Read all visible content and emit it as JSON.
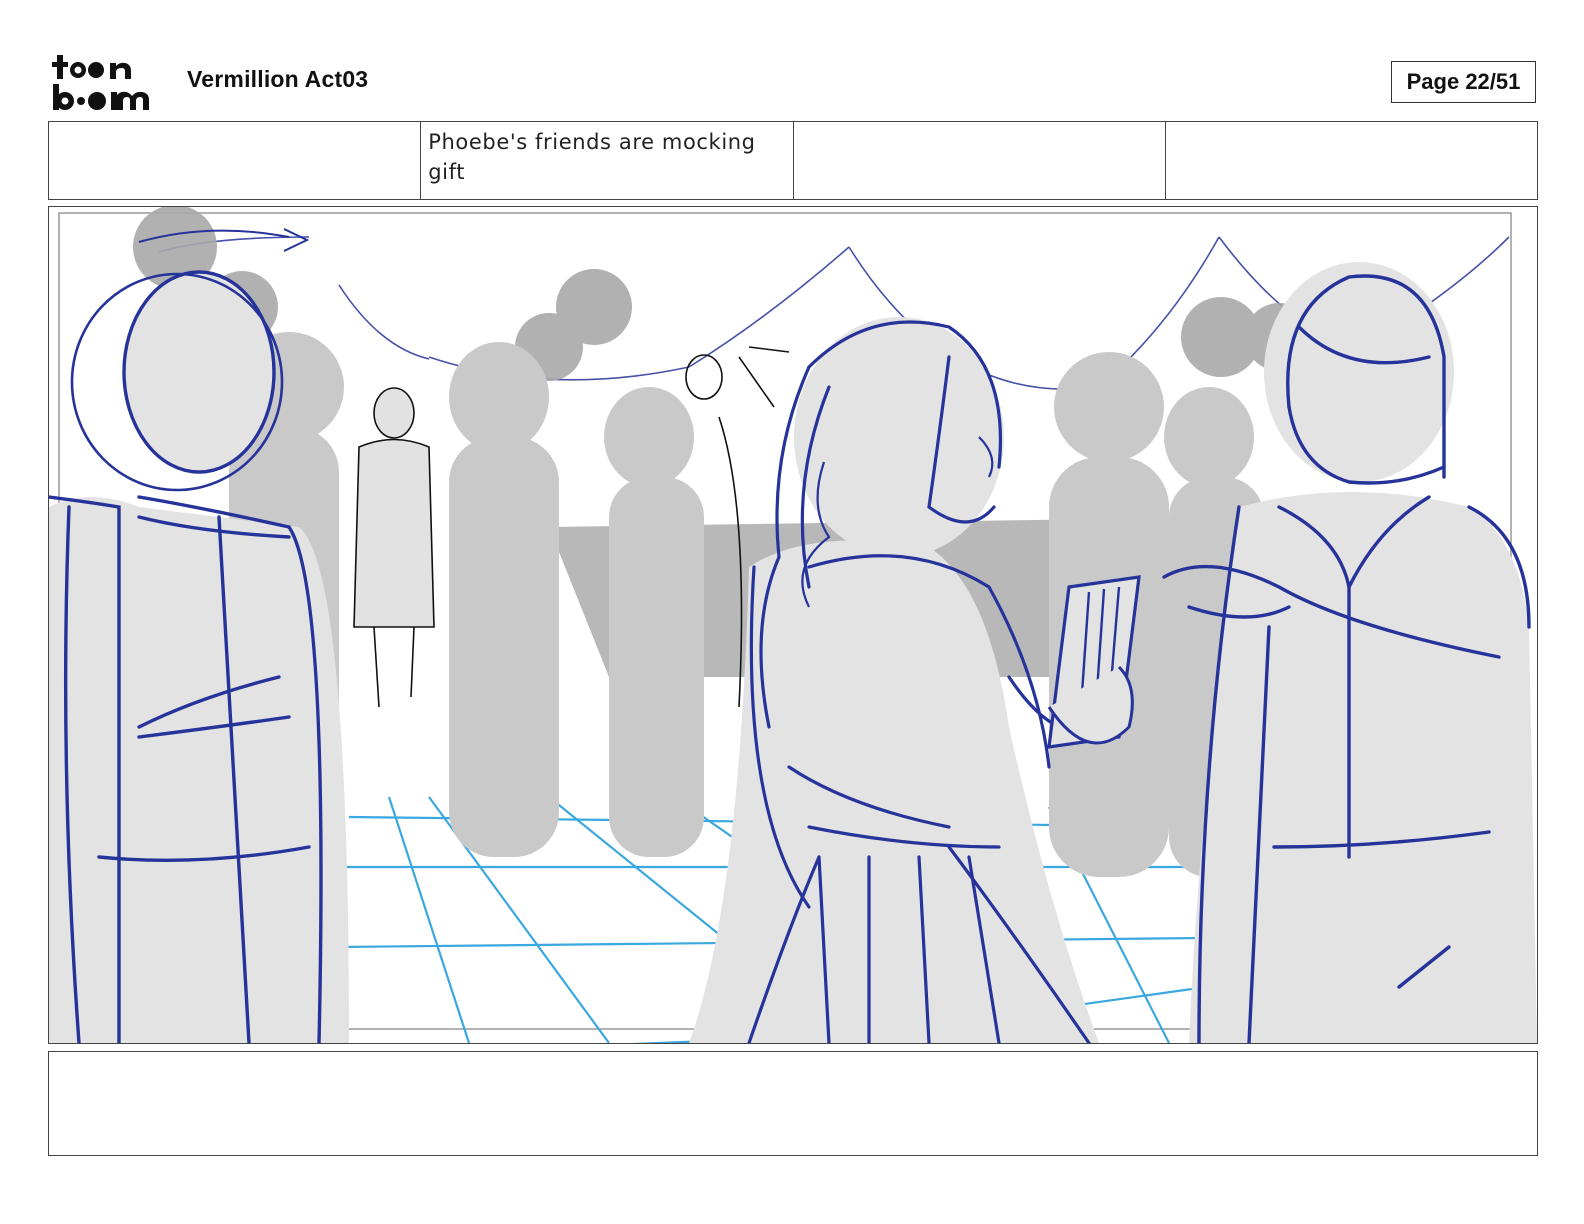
{
  "header": {
    "logo_alt": "toon boom",
    "project_title": "Vermillion Act03",
    "page_label": "Page 22/51"
  },
  "info_row": {
    "cells": [
      "",
      "Phoebe's friends are mocking gift",
      "",
      ""
    ]
  },
  "panel": {
    "description": ""
  },
  "notes": {
    "text": ""
  },
  "colors": {
    "sketch_blue": "#25339a",
    "floor_grid": "#3aa7e0",
    "fill_gray": "#e3e3e3",
    "mid_gray": "#a9a9a9",
    "frame": "#444444"
  }
}
